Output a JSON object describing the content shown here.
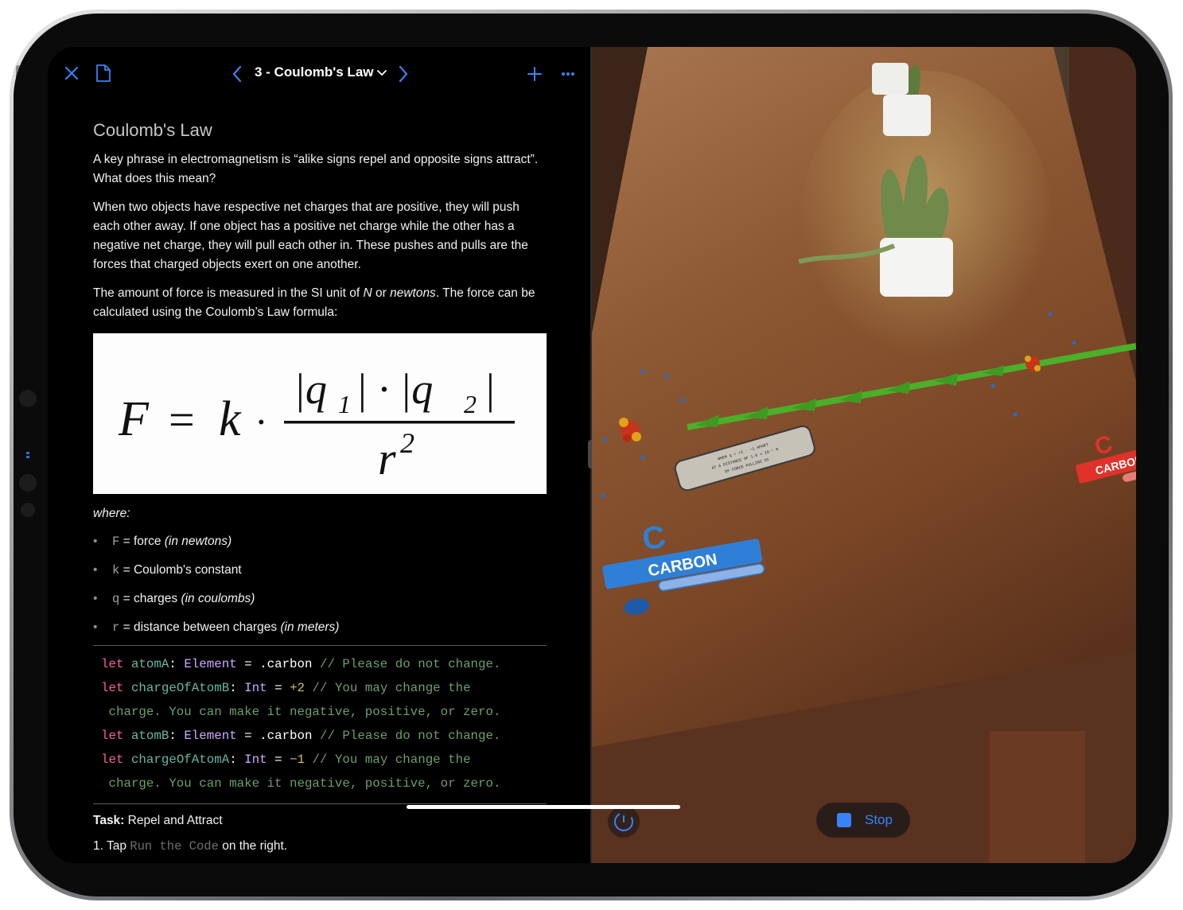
{
  "nav": {
    "title": "3 - Coulomb's Law",
    "close_icon": "close-icon",
    "document_icon": "document-icon",
    "prev_icon": "chevron-left-icon",
    "next_icon": "chevron-right-icon",
    "dropdown_icon": "chevron-down-icon",
    "add_icon": "plus-icon",
    "more_icon": "ellipsis-icon"
  },
  "content": {
    "heading": "Coulomb's Law",
    "para1": "A key phrase in electromagnetism is “alike signs repel and opposite signs attract”. What does this mean?",
    "para2": "When two objects have respective net charges that are positive, they will push each other away. If one object has a positive net charge while the other has a negative net charge, they will pull each other in. These pushes and pulls are the forces that charged objects exert on one another.",
    "para3_a": "The amount of force is measured in the SI unit of ",
    "para3_N": "N",
    "para3_or": " or ",
    "para3_newtons": "newtons",
    "para3_b": ". The force can be calculated using the Coulomb’s Law formula:",
    "formula": {
      "F": "F",
      "eq": "=",
      "k": "k",
      "dot": "·",
      "numerator_q1": "|q",
      "sub1": "1",
      "numerator_mid": "| · |q",
      "sub2": "2",
      "numerator_end": "|",
      "denom_r": "r",
      "denom_exp": "2"
    },
    "where": "where:",
    "bullets": [
      {
        "sym": "F",
        "text": " = force ",
        "em": "(in newtons)"
      },
      {
        "sym": "k",
        "text": " = Coulomb's constant",
        "em": ""
      },
      {
        "sym": "q",
        "text": " = charges ",
        "em": "(in coulombs)"
      },
      {
        "sym": "r",
        "text": " = distance between charges ",
        "em": "(in meters)"
      }
    ],
    "code": {
      "let": "let",
      "atomA": "atomA",
      "chargeOfAtomB": "chargeOfAtomB",
      "atomB": "atomB",
      "chargeOfAtomA": "chargeOfAtomA",
      "Element": "Element",
      "Int": "Int",
      "colon": ": ",
      "assign": " = ",
      "carbon": ".carbon",
      "plus2": "+2",
      "minus1": "−1",
      "comment_nochange": " // Please do not change.",
      "comment_may": " // You may change the",
      "comment_cont": " charge. You can make it negative, positive, or zero."
    },
    "task_label": "Task:",
    "task_title": " Repel and Attract",
    "step1_num": "1.",
    "step1_a": " Tap ",
    "step1_code": "Run the Code",
    "step1_b": " on the right."
  },
  "ar": {
    "label_left": "CARBON",
    "label_right": "CARBON",
    "symbol": "C",
    "plaque_line1": "WHEN q = +2 · −1 APART",
    "plaque_line2": "AT A DISTANCE OF 1.0 × 10⁻¹ M",
    "plaque_line3": "OF FORCE PULLING US"
  },
  "controls": {
    "meter_icon": "gauge-icon",
    "stop_label": "Stop",
    "stop_icon": "stop-icon"
  },
  "colors": {
    "accent": "#3a82f7",
    "keyword": "#fc5fa3",
    "comment": "#6c9f6c",
    "carbon_blue": "#2f7fd6",
    "carbon_red": "#e0322b",
    "force_arrow": "#4caf2a"
  }
}
